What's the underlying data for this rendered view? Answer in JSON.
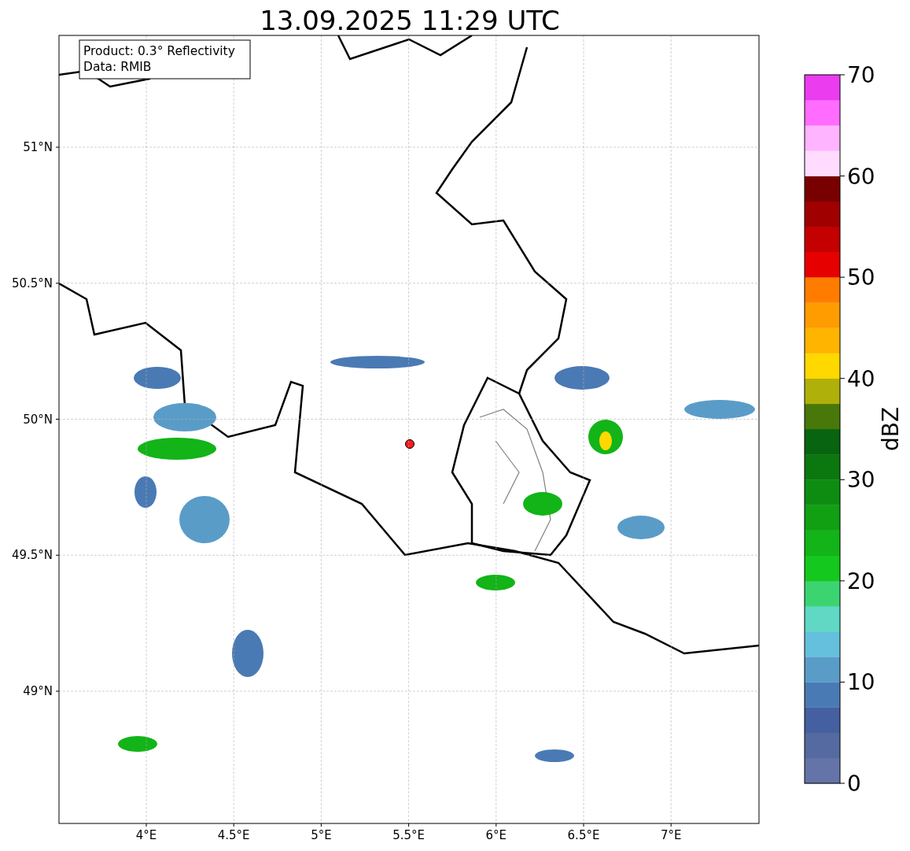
{
  "title": "13.09.2025 11:29 UTC",
  "map": {
    "info_box": [
      "Product: 0.3° Reflectivity",
      "Data: RMIB"
    ],
    "lat_ticks": [
      "51°N",
      "50.5°N",
      "50°N",
      "49.5°N",
      "49°N"
    ],
    "lon_ticks": [
      "4°E",
      "4.5°E",
      "5°E",
      "5.5°E",
      "6°E",
      "6.5°E",
      "7°E"
    ]
  },
  "colorbar": {
    "label": "dBZ",
    "ticks": [
      "70",
      "60",
      "50",
      "40",
      "30",
      "20",
      "10",
      "0"
    ],
    "bins": [
      {
        "color": "#6474a8"
      },
      {
        "color": "#546aa0"
      },
      {
        "color": "#4560a0"
      },
      {
        "color": "#4a7ab4"
      },
      {
        "color": "#5a9cc8"
      },
      {
        "color": "#64c0dc"
      },
      {
        "color": "#60d8c4"
      },
      {
        "color": "#3cd470"
      },
      {
        "color": "#14c81e"
      },
      {
        "color": "#12b418"
      },
      {
        "color": "#10a012"
      },
      {
        "color": "#0e8c12"
      },
      {
        "color": "#0a780e"
      },
      {
        "color": "#086410"
      },
      {
        "color": "#48780a"
      },
      {
        "color": "#b0b00a"
      },
      {
        "color": "#ffd800"
      },
      {
        "color": "#ffb400"
      },
      {
        "color": "#ff9c00"
      },
      {
        "color": "#ff7c00"
      },
      {
        "color": "#e60000"
      },
      {
        "color": "#c40000"
      },
      {
        "color": "#a00000"
      },
      {
        "color": "#780000"
      },
      {
        "color": "#ffdcff"
      },
      {
        "color": "#ffb4ff"
      },
      {
        "color": "#ff6cff"
      },
      {
        "color": "#eb3cf0"
      }
    ]
  }
}
